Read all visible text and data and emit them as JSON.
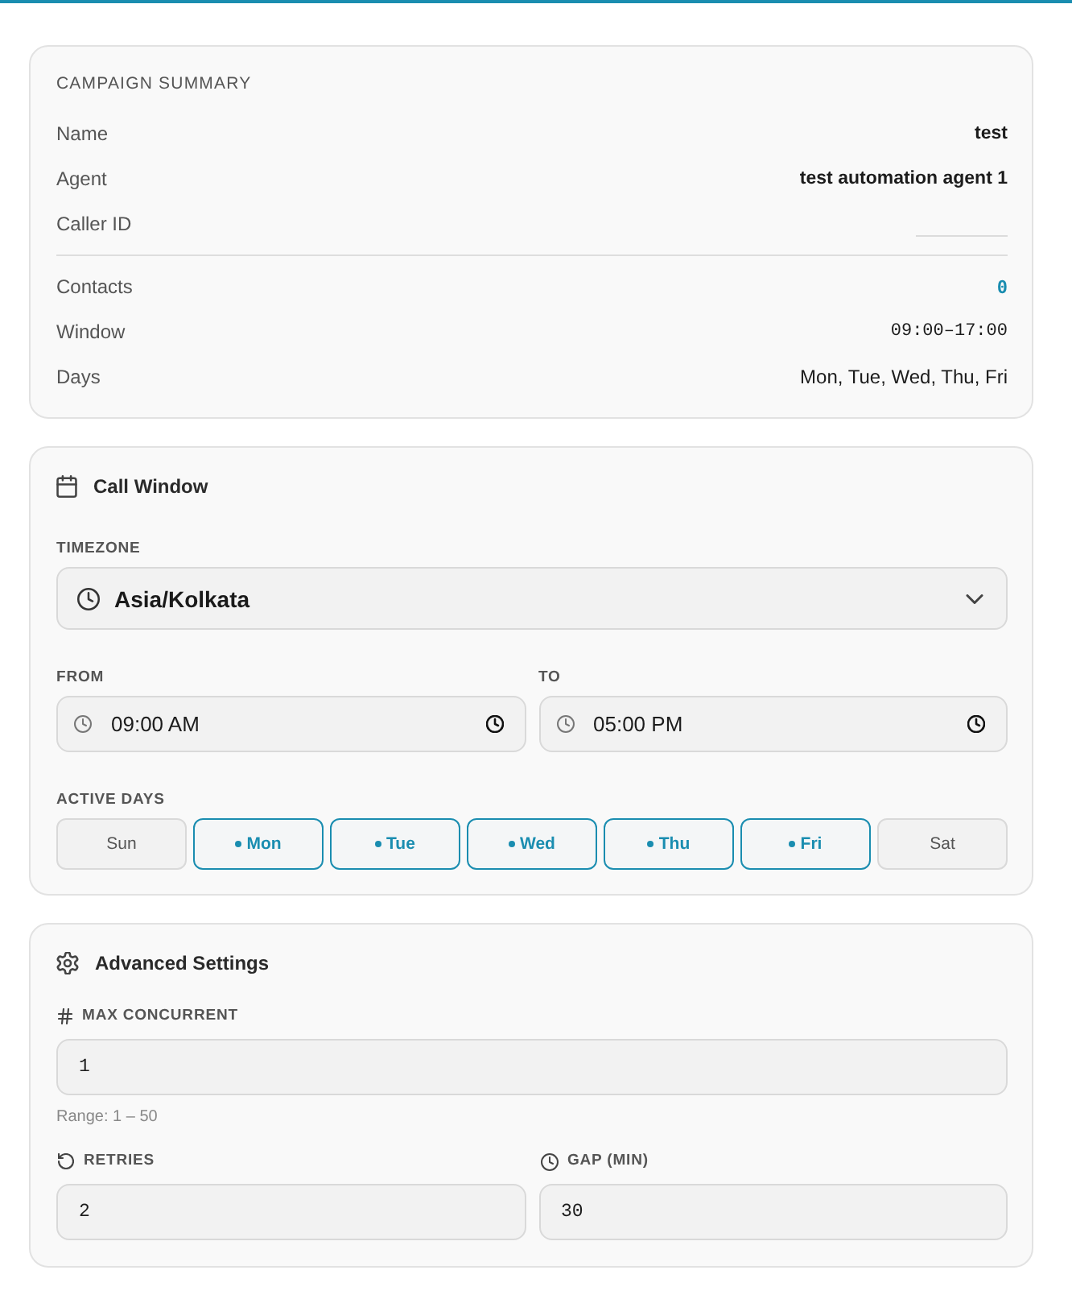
{
  "summary": {
    "title": "CAMPAIGN SUMMARY",
    "sections": [
      {
        "rows": [
          {
            "label": "Name",
            "value": "test",
            "kind": "emphasis"
          },
          {
            "label": "Agent",
            "value": "test automation agent 1",
            "kind": "emphasis"
          },
          {
            "label": "Caller ID",
            "kind": "blank"
          }
        ]
      },
      {
        "rows": [
          {
            "label": "Contacts",
            "value": "0",
            "kind": "count"
          },
          {
            "label": "Window",
            "value": "09:00–17:00",
            "kind": "mono"
          },
          {
            "label": "Days",
            "value": "Mon, Tue, Wed, Thu, Fri",
            "kind": "plain"
          }
        ]
      }
    ]
  },
  "call_window": {
    "title": "Call Window",
    "timezone": {
      "label": "TIMEZONE",
      "value": "Asia/Kolkata"
    },
    "from": {
      "label": "FROM",
      "value": "09:00 AM"
    },
    "to": {
      "label": "TO",
      "value": "05:00 PM"
    },
    "active_days": {
      "label": "ACTIVE DAYS",
      "days": [
        {
          "label": "Sun",
          "selected": false
        },
        {
          "label": "Mon",
          "selected": true
        },
        {
          "label": "Tue",
          "selected": true
        },
        {
          "label": "Wed",
          "selected": true
        },
        {
          "label": "Thu",
          "selected": true
        },
        {
          "label": "Fri",
          "selected": true
        },
        {
          "label": "Sat",
          "selected": false
        }
      ]
    }
  },
  "advanced_settings": {
    "title": "Advanced Settings",
    "max_concurrent": {
      "label": "MAX CONCURRENT",
      "value": "1",
      "hint": "Range: 1 – 50"
    },
    "retries": {
      "label": "RETRIES",
      "value": "2"
    },
    "gap": {
      "label": "GAP (MIN)",
      "value": "30"
    }
  }
}
